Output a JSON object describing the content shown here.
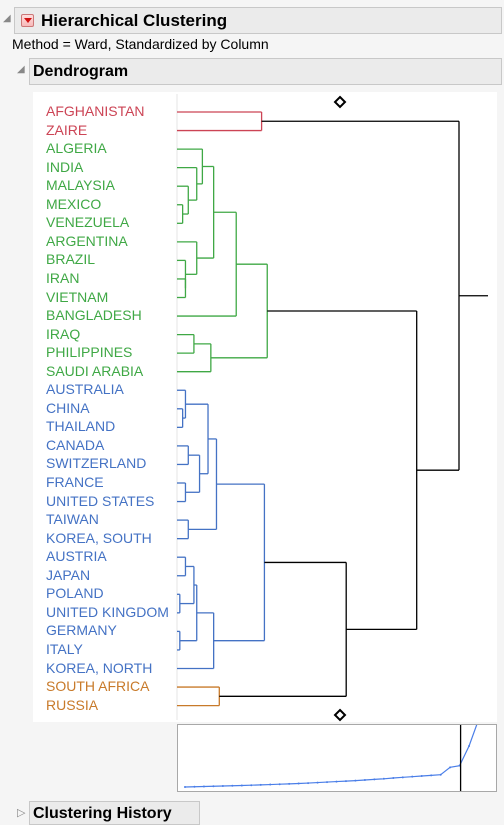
{
  "report": {
    "title": "Hierarchical Clustering",
    "method_text": "Method = Ward, Standardized by Column",
    "red_triangle_menu_icon": "red-triangle-menu-icon"
  },
  "dendrogram": {
    "title": "Dendrogram",
    "colors": {
      "red": "#cc4455",
      "green": "#3fa845",
      "blue": "#4472c4",
      "orange": "#c87a2a",
      "black": "#000000"
    },
    "leaves": [
      {
        "label": "AFGHANISTAN",
        "cluster": "red"
      },
      {
        "label": "ZAIRE",
        "cluster": "red"
      },
      {
        "label": "ALGERIA",
        "cluster": "green"
      },
      {
        "label": "INDIA",
        "cluster": "green"
      },
      {
        "label": "MALAYSIA",
        "cluster": "green"
      },
      {
        "label": "MEXICO",
        "cluster": "green"
      },
      {
        "label": "VENEZUELA",
        "cluster": "green"
      },
      {
        "label": "ARGENTINA",
        "cluster": "green"
      },
      {
        "label": "BRAZIL",
        "cluster": "green"
      },
      {
        "label": "IRAN",
        "cluster": "green"
      },
      {
        "label": "VIETNAM",
        "cluster": "green"
      },
      {
        "label": "BANGLADESH",
        "cluster": "green"
      },
      {
        "label": "IRAQ",
        "cluster": "green"
      },
      {
        "label": "PHILIPPINES",
        "cluster": "green"
      },
      {
        "label": "SAUDI ARABIA",
        "cluster": "green"
      },
      {
        "label": "AUSTRALIA",
        "cluster": "blue"
      },
      {
        "label": "CHINA",
        "cluster": "blue"
      },
      {
        "label": "THAILAND",
        "cluster": "blue"
      },
      {
        "label": "CANADA",
        "cluster": "blue"
      },
      {
        "label": "SWITZERLAND",
        "cluster": "blue"
      },
      {
        "label": "FRANCE",
        "cluster": "blue"
      },
      {
        "label": "UNITED STATES",
        "cluster": "blue"
      },
      {
        "label": "TAIWAN",
        "cluster": "blue"
      },
      {
        "label": "KOREA, SOUTH",
        "cluster": "blue"
      },
      {
        "label": "AUSTRIA",
        "cluster": "blue"
      },
      {
        "label": "JAPAN",
        "cluster": "blue"
      },
      {
        "label": "POLAND",
        "cluster": "blue"
      },
      {
        "label": "UNITED KINGDOM",
        "cluster": "blue"
      },
      {
        "label": "GERMANY",
        "cluster": "blue"
      },
      {
        "label": "ITALY",
        "cluster": "blue"
      },
      {
        "label": "KOREA, NORTH",
        "cluster": "blue"
      },
      {
        "label": "SOUTH AFRICA",
        "cluster": "orange"
      },
      {
        "label": "RUSSIA",
        "cluster": "orange"
      }
    ],
    "merges": [
      {
        "a": "L0",
        "b": "L1",
        "dist": 0.3,
        "color": "red"
      },
      {
        "a": "L5",
        "b": "L6",
        "dist": 0.02,
        "color": "green"
      },
      {
        "a": "L4",
        "b": "M1",
        "dist": 0.04,
        "color": "green"
      },
      {
        "a": "L3",
        "b": "M2",
        "dist": 0.07,
        "color": "green"
      },
      {
        "a": "L2",
        "b": "M3",
        "dist": 0.09,
        "color": "green"
      },
      {
        "a": "L9",
        "b": "L10",
        "dist": 0.03,
        "color": "green"
      },
      {
        "a": "L8",
        "b": "M5",
        "dist": 0.03,
        "color": "green"
      },
      {
        "a": "L7",
        "b": "M6",
        "dist": 0.07,
        "color": "green"
      },
      {
        "a": "M4",
        "b": "M7",
        "dist": 0.13,
        "color": "green"
      },
      {
        "a": "M8",
        "b": "L11",
        "dist": 0.21,
        "color": "green"
      },
      {
        "a": "L12",
        "b": "L13",
        "dist": 0.06,
        "color": "green"
      },
      {
        "a": "M10",
        "b": "L14",
        "dist": 0.12,
        "color": "green"
      },
      {
        "a": "M9",
        "b": "M11",
        "dist": 0.32,
        "color": "green"
      },
      {
        "a": "L16",
        "b": "L17",
        "dist": 0.02,
        "color": "blue"
      },
      {
        "a": "L15",
        "b": "M13",
        "dist": 0.03,
        "color": "blue"
      },
      {
        "a": "L18",
        "b": "L19",
        "dist": 0.04,
        "color": "blue"
      },
      {
        "a": "L20",
        "b": "L21",
        "dist": 0.03,
        "color": "blue"
      },
      {
        "a": "M15",
        "b": "M16",
        "dist": 0.08,
        "color": "blue"
      },
      {
        "a": "M14",
        "b": "M17",
        "dist": 0.11,
        "color": "blue"
      },
      {
        "a": "L22",
        "b": "L23",
        "dist": 0.04,
        "color": "blue"
      },
      {
        "a": "M18",
        "b": "M19",
        "dist": 0.14,
        "color": "blue"
      },
      {
        "a": "L24",
        "b": "L25",
        "dist": 0.03,
        "color": "blue"
      },
      {
        "a": "L26",
        "b": "L27",
        "dist": 0.01,
        "color": "blue"
      },
      {
        "a": "M21",
        "b": "M22",
        "dist": 0.06,
        "color": "blue"
      },
      {
        "a": "L28",
        "b": "L29",
        "dist": 0.01,
        "color": "blue"
      },
      {
        "a": "M23",
        "b": "M24",
        "dist": 0.07,
        "color": "blue"
      },
      {
        "a": "M25",
        "b": "L30",
        "dist": 0.13,
        "color": "blue"
      },
      {
        "a": "M20",
        "b": "M26",
        "dist": 0.31,
        "color": "blue"
      },
      {
        "a": "L31",
        "b": "L32",
        "dist": 0.15,
        "color": "orange"
      },
      {
        "a": "M27",
        "b": "M28",
        "dist": 0.6,
        "color": "black"
      },
      {
        "a": "M12",
        "b": "M29",
        "dist": 0.85,
        "color": "black"
      },
      {
        "a": "M0",
        "b": "M30",
        "dist": 1.0,
        "color": "black"
      }
    ],
    "distance_slider_icon": "diamond-icon"
  },
  "scree_plot": {
    "series_color": "#4a7ee8",
    "values": [
      0.0,
      0.003,
      0.006,
      0.009,
      0.012,
      0.015,
      0.018,
      0.022,
      0.026,
      0.03,
      0.034,
      0.038,
      0.043,
      0.048,
      0.054,
      0.06,
      0.066,
      0.072,
      0.078,
      0.085,
      0.093,
      0.1,
      0.11,
      0.118,
      0.126,
      0.134,
      0.142,
      0.15,
      0.24,
      0.26,
      0.5,
      0.82,
      1.0
    ],
    "cut_index": 29
  },
  "clustering_history": {
    "title": "Clustering History"
  }
}
